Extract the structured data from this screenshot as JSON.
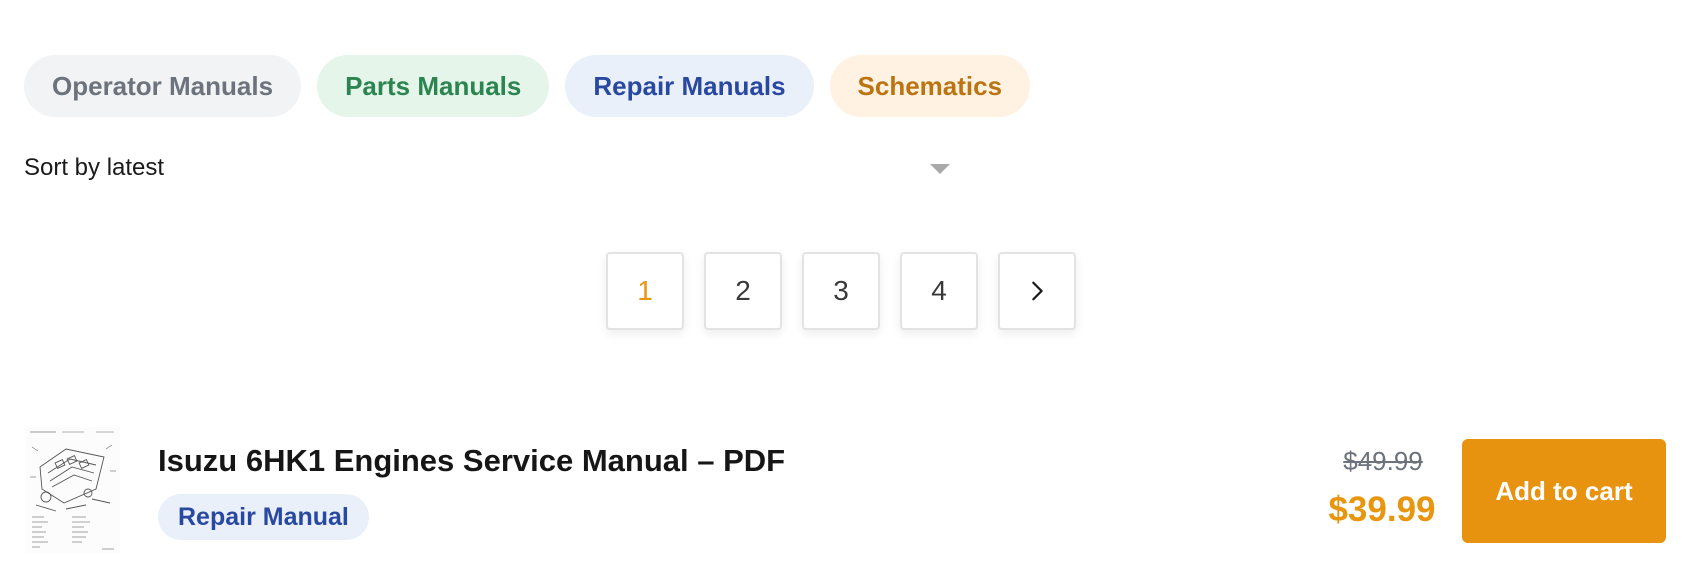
{
  "categories": [
    {
      "label": "Operator Manuals",
      "color": "#6c737c"
    },
    {
      "label": "Parts Manuals",
      "color": "#2b8551"
    },
    {
      "label": "Repair Manuals",
      "color": "#2949a0"
    },
    {
      "label": "Schematics",
      "color": "#bc7410"
    }
  ],
  "sort": {
    "selected": "Sort by latest",
    "icon": "caret-down-icon"
  },
  "pagination": {
    "pages": [
      "1",
      "2",
      "3",
      "4"
    ],
    "current": "1",
    "next_icon": "chevron-right-icon",
    "active_color": "#e8960f"
  },
  "product": {
    "title": "Isuzu 6HK1 Engines Service Manual – PDF",
    "badge": "Repair Manual",
    "price_old": "$49.99",
    "price_new": "$39.99",
    "add_to_cart_label": "Add to cart",
    "thumbnail_icon": "engine-diagram-thumbnail",
    "accent_color": "#e8930f"
  }
}
